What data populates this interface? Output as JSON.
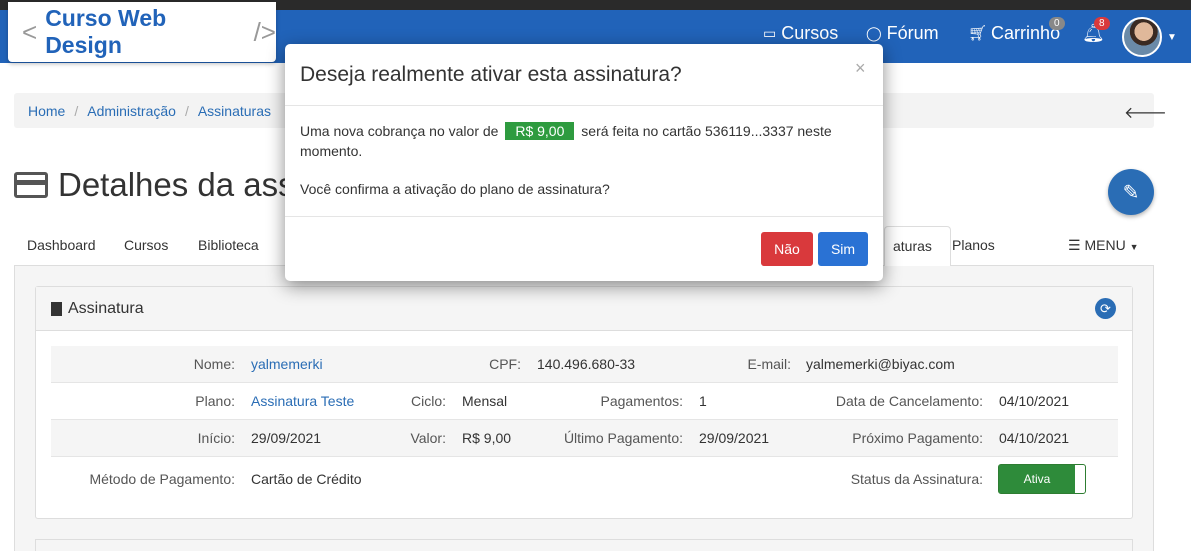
{
  "brand": {
    "text": "Curso Web Design",
    "left": "<",
    "right": "/>"
  },
  "nav": {
    "cursos": "Cursos",
    "forum": "Fórum",
    "carrinho": "Carrinho",
    "cart_badge": "0",
    "notif_badge": "8"
  },
  "breadcrumb": [
    "Home",
    "Administração",
    "Assinaturas"
  ],
  "page_title": "Detalhes da assi",
  "tabs": {
    "dashboard": "Dashboard",
    "cursos": "Cursos",
    "biblioteca": "Biblioteca",
    "assinaturas": "aturas",
    "planos": "Planos",
    "menu": "MENU"
  },
  "panel": {
    "title": "Assinatura",
    "row1": {
      "nome_l": "Nome:",
      "nome_v": "yalmemerki",
      "cpf_l": "CPF:",
      "cpf_v": "140.496.680-33",
      "email_l": "E-mail:",
      "email_v": "yalmemerki@biyac.com"
    },
    "row2": {
      "plano_l": "Plano:",
      "plano_v": "Assinatura Teste",
      "ciclo_l": "Ciclo:",
      "ciclo_v": "Mensal",
      "pag_l": "Pagamentos:",
      "pag_v": "1",
      "canc_l": "Data de Cancelamento:",
      "canc_v": "04/10/2021"
    },
    "row3": {
      "inicio_l": "Início:",
      "inicio_v": "29/09/2021",
      "valor_l": "Valor:",
      "valor_v": "R$ 9,00",
      "ult_l": "Último Pagamento:",
      "ult_v": "29/09/2021",
      "prox_l": "Próximo Pagamento:",
      "prox_v": "04/10/2021"
    },
    "row4": {
      "metodo_l": "Método de Pagamento:",
      "metodo_v": "Cartão de Crédito",
      "status_l": "Status da Assinatura:",
      "status_v": "Ativa"
    }
  },
  "modal": {
    "title": "Deseja realmente ativar esta assinatura?",
    "close": "×",
    "text_before": "Uma nova cobrança no valor de",
    "price": "R$ 9,00",
    "text_after": "será feita no cartão 536119...3337 neste momento.",
    "confirm_text": "Você confirma a ativação do plano de assinatura?",
    "no_label": "Não",
    "yes_label": "Sim"
  },
  "colors": {
    "primary": "#2163b9",
    "success": "#2e9b3f",
    "danger": "#d9393c",
    "button_primary": "#2a72d4"
  }
}
